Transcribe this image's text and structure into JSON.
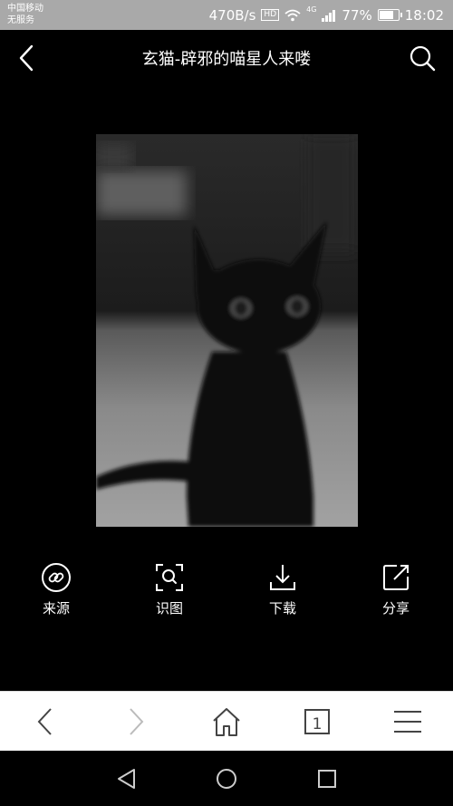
{
  "status": {
    "carrier_line1": "中国移动",
    "carrier_line2": "无服务",
    "speed": "470B/s",
    "hd": "HD",
    "signal": "4G",
    "battery": "77%",
    "battery_level": 0.77,
    "time": "18:02"
  },
  "header": {
    "title": "玄猫-辟邪的喵星人来喽"
  },
  "actions": [
    {
      "label": "来源",
      "icon": "link-icon"
    },
    {
      "label": "识图",
      "icon": "image-search-icon"
    },
    {
      "label": "下载",
      "icon": "download-icon"
    },
    {
      "label": "分享",
      "icon": "share-icon"
    }
  ],
  "browser": {
    "tab_count": "1"
  }
}
